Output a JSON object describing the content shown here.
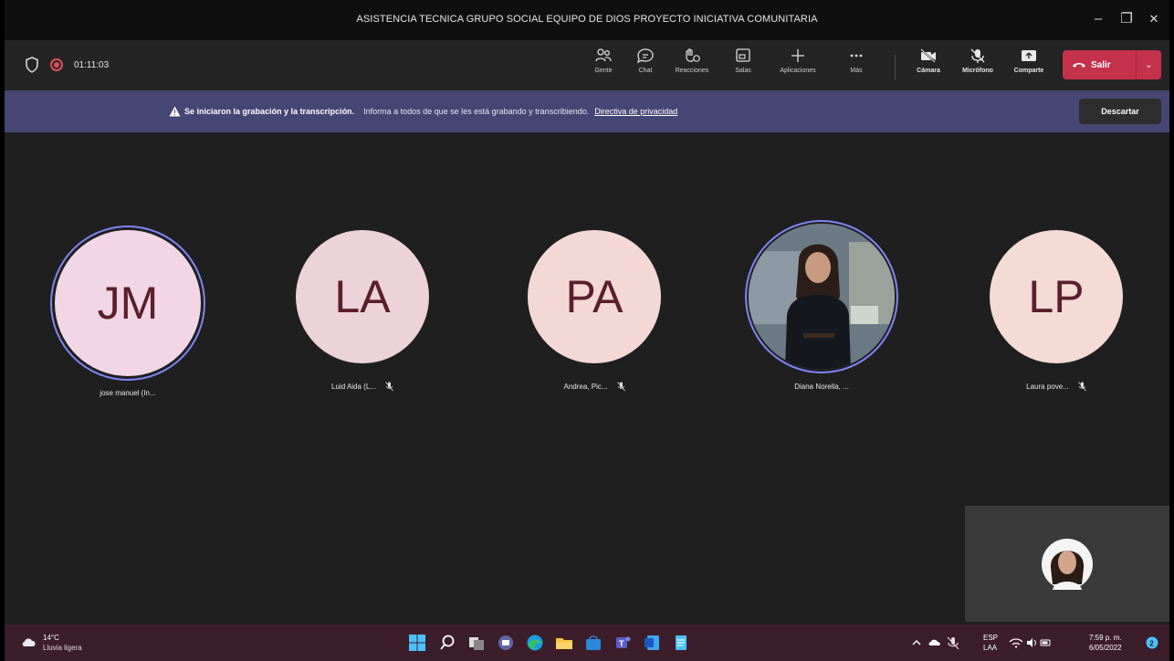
{
  "window": {
    "title": "ASISTENCIA TECNICA GRUPO SOCIAL EQUIPO DE DIOS PROYECTO INICIATIVA COMUNITARIA",
    "minimize": "–",
    "maximize": "❐",
    "close": "✕"
  },
  "meeting": {
    "timer": "01:11:03"
  },
  "toolbar": {
    "people": "Gente",
    "chat": "Chat",
    "reactions": "Reacciones",
    "rooms": "Salas",
    "apps": "Aplicaciones",
    "more": "Más",
    "camera": "Cámara",
    "mic": "Micrófono",
    "share": "Comparte",
    "leave": "Salir",
    "leave_caret": "⌄"
  },
  "banner": {
    "bold": "Se iniciaron la grabación y la transcripción.",
    "info": "Informa a todos de que se les está grabando y transcribiendo.",
    "link": "Directiva de privacidad",
    "dismiss": "Descartar"
  },
  "participants": [
    {
      "initials": "JM",
      "name": "jose manuel (In...",
      "muted": false,
      "color": "#f2d6e6"
    },
    {
      "initials": "LA",
      "name": "Luid Aida (L...",
      "muted": true,
      "color": "#ecd2d9"
    },
    {
      "initials": "PA",
      "name": "Andrea, Pic...",
      "muted": true,
      "color": "#f3d8d6"
    },
    {
      "initials": "",
      "name": "Diana Norella, ...",
      "muted": false,
      "color": "#5c6c77"
    },
    {
      "initials": "LP",
      "name": "Laura pove...",
      "muted": true,
      "color": "#f4dbd6"
    }
  ],
  "taskbar": {
    "temp": "14°C",
    "weather": "Lluvia ligera",
    "lang1": "ESP",
    "lang2": "LAA",
    "time": "7:59 p. m.",
    "date": "6/05/2022"
  }
}
